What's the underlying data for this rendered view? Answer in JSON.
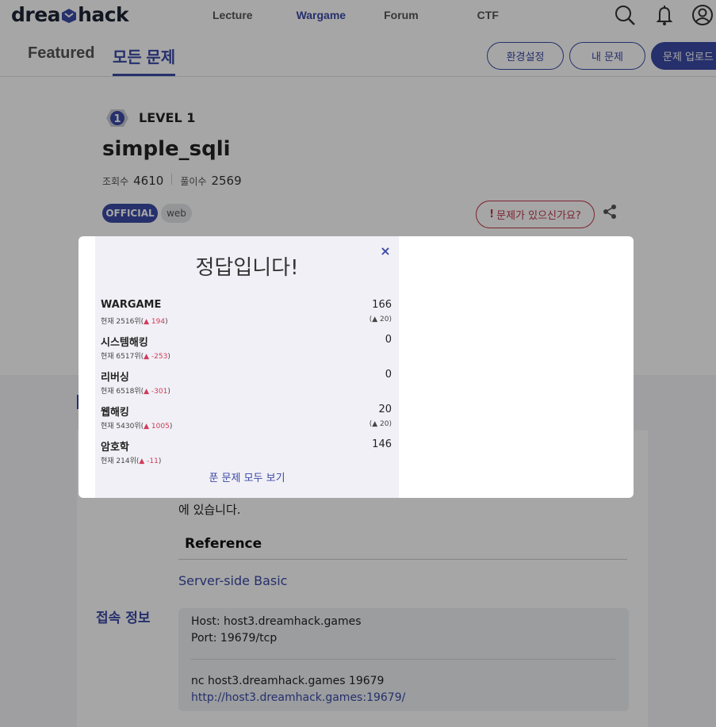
{
  "nav": {
    "logo_left": "drea",
    "logo_right": "hack",
    "links": [
      "Lecture",
      "Wargame",
      "Forum",
      "CTF"
    ],
    "active_link": "Wargame",
    "icons": [
      "search-icon",
      "bell-icon",
      "user-icon"
    ]
  },
  "subnav": {
    "tab_featured": "Featured",
    "tab_all": "모든 문제",
    "settings_label": "환경설정",
    "my_problems_label": "내 문제",
    "upload_label": "문제 업로드"
  },
  "challenge": {
    "level": "LEVEL 1",
    "level_number": "1",
    "title": "simple_sqli",
    "views_label": "조회수",
    "views": "4610",
    "solves_label": "풀이수",
    "solves": "2569",
    "tag_official": "OFFICIAL",
    "tag_web": "web",
    "report_label": "문제가 있으신가요?",
    "report_excl": "!"
  },
  "content": {
    "desc_tail": "에 있습니다.",
    "reference_heading": "Reference",
    "reference_link": "Server-side Basic",
    "access_label": "접속 정보",
    "host_line": "Host: host3.dreamhack.games",
    "port_line": "Port: 19679/tcp",
    "nc_line": "nc host3.dreamhack.games 19679",
    "url_line": "http://host3.dreamhack.games:19679/"
  },
  "modal": {
    "title": "정답입니다!",
    "close": "×",
    "rows": [
      {
        "name": "WARGAME",
        "score": "166",
        "sub_prefix": "현재 2516위(",
        "delta": "▲ 194",
        "sub_suffix": ")",
        "gain": "(▲ 20)"
      },
      {
        "name": "시스템해킹",
        "score": "0",
        "sub_prefix": "현재 6517위(",
        "delta": "▲ -253",
        "sub_suffix": ")",
        "gain": ""
      },
      {
        "name": "리버싱",
        "score": "0",
        "sub_prefix": "현재 6518위(",
        "delta": "▲ -301",
        "sub_suffix": ")",
        "gain": ""
      },
      {
        "name": "웹해킹",
        "score": "20",
        "sub_prefix": "현재 5430위(",
        "delta": "▲ 1005",
        "sub_suffix": ")",
        "gain": "(▲ 20)"
      },
      {
        "name": "암호학",
        "score": "146",
        "sub_prefix": "현재 214위(",
        "delta": "▲ -11",
        "sub_suffix": ")",
        "gain": ""
      }
    ],
    "view_all": "푼 문제 모두 보기"
  },
  "colors": {
    "brand": "#3b4aa6",
    "danger": "#d23a57",
    "panel": "#f1f0f6"
  }
}
